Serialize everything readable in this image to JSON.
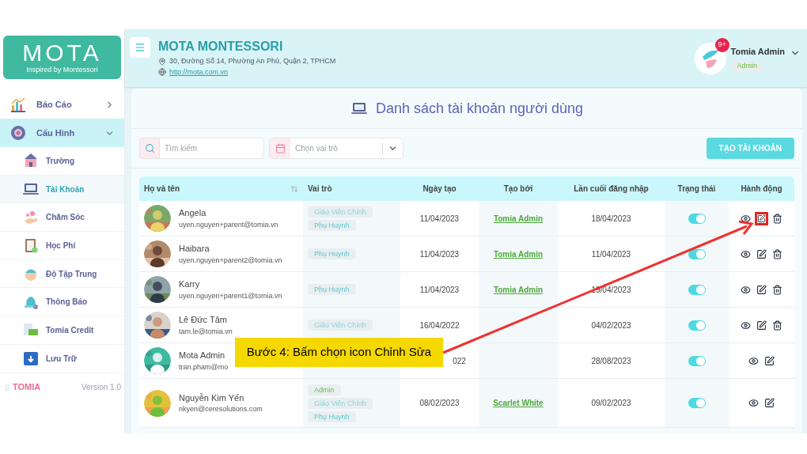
{
  "sidebar": {
    "logo": {
      "title": "MOTA",
      "subtitle": "Inspired by Montessori"
    },
    "items": [
      {
        "label": "Báo Cáo",
        "kind": "chart",
        "selected": false,
        "expanded": false
      },
      {
        "label": "Cấu Hình",
        "kind": "gear",
        "selected": true,
        "expanded": true,
        "children": [
          {
            "label": "Trường",
            "kind": "school",
            "selected": false
          },
          {
            "label": "Tài Khoản",
            "kind": "laptop",
            "selected": true
          },
          {
            "label": "Chăm Sóc",
            "kind": "hand",
            "selected": false
          },
          {
            "label": "Học Phí",
            "kind": "clipboard",
            "selected": false
          },
          {
            "label": "Độ Tập Trung",
            "kind": "face",
            "selected": false
          },
          {
            "label": "Thông Báo",
            "kind": "bell",
            "selected": false
          },
          {
            "label": "Tomia Credit",
            "kind": "card",
            "selected": false
          },
          {
            "label": "Lưu Trữ",
            "kind": "archive",
            "selected": false
          }
        ]
      }
    ],
    "footer": {
      "brand": "TOMIA",
      "version": "Version 1.0"
    }
  },
  "header": {
    "school": "MOTA MONTESSORI",
    "address": "30, Đường Số 14, Phường An Phú, Quận 2, TPHCM",
    "website": "http://mota.com.vn",
    "user": {
      "name": "Tomia Admin",
      "role": "Admin",
      "notifications": "9+"
    }
  },
  "page": {
    "title": "Danh sách tài khoản người dùng",
    "search": {
      "placeholder": "Tìm kiếm"
    },
    "role_select": {
      "placeholder": "Chọn vai trò"
    },
    "create_button": "TẠO TÀI KHOẢN"
  },
  "table": {
    "columns": [
      "Họ và tên",
      "Vai trò",
      "Ngày tạo",
      "Tạo bởi",
      "Lần cuối đăng nhập",
      "Trạng thái",
      "Hành động"
    ],
    "rows": [
      {
        "name": "Angela",
        "email": "uyen.nguyen+parent@tomia.vn",
        "roles": [
          {
            "label": "Giáo Viên Chính",
            "kind": "teacher"
          },
          {
            "label": "Phụ Huynh",
            "kind": "parent"
          }
        ],
        "created": "11/04/2023",
        "created_by": "Tomia Admin",
        "last_login": "18/04/2023",
        "on": true,
        "actions": [
          {
            "kind": "view",
            "highlighted": false
          },
          {
            "kind": "edit",
            "highlighted": true
          },
          {
            "kind": "delete",
            "highlighted": false
          }
        ]
      },
      {
        "name": "Haibara",
        "email": "uyen.nguyen+parent2@tomia.vn",
        "roles": [
          {
            "label": "Phụ Huynh",
            "kind": "parent"
          }
        ],
        "created": "11/04/2023",
        "created_by": "Tomia Admin",
        "last_login": "11/04/2023",
        "on": true,
        "actions": [
          {
            "kind": "view",
            "highlighted": false
          },
          {
            "kind": "edit",
            "highlighted": false
          },
          {
            "kind": "delete",
            "highlighted": false
          }
        ]
      },
      {
        "name": "Karry",
        "email": "uyen.nguyen+parent1@tomia.vn",
        "roles": [
          {
            "label": "Phụ Huynh",
            "kind": "parent"
          }
        ],
        "created": "11/04/2023",
        "created_by": "Tomia Admin",
        "last_login": "19/04/2023",
        "on": true,
        "actions": [
          {
            "kind": "view",
            "highlighted": false
          },
          {
            "kind": "edit",
            "highlighted": false
          },
          {
            "kind": "delete",
            "highlighted": false
          }
        ]
      },
      {
        "name": "Lê Đức Tâm",
        "email": "tam.le@tomia.vn",
        "roles": [
          {
            "label": "Giáo Viên Chính",
            "kind": "teacher"
          }
        ],
        "created": "16/04/2022",
        "last_login": "04/02/2023",
        "on": true,
        "actions": [
          {
            "kind": "view",
            "highlighted": false
          },
          {
            "kind": "edit",
            "highlighted": false
          },
          {
            "kind": "delete",
            "highlighted": false
          }
        ]
      },
      {
        "name": "Mota Admin",
        "email": "tran.pham@mo",
        "created": "022",
        "last_login": "28/08/2023",
        "on": true,
        "actions": [
          {
            "kind": "view",
            "highlighted": false
          },
          {
            "kind": "edit",
            "highlighted": false
          }
        ]
      },
      {
        "name": "Nguyễn Kim Yến",
        "email": "nkyen@ceresolutions.com",
        "roles": [
          {
            "label": "Admin",
            "kind": "admin"
          },
          {
            "label": "Giáo Viên Chính",
            "kind": "teacher"
          },
          {
            "label": "Phụ Huynh",
            "kind": "parent"
          }
        ],
        "created": "08/02/2023",
        "created_by": "Scarlet White",
        "last_login": "09/02/2023",
        "on": true,
        "actions": [
          {
            "kind": "view",
            "highlighted": false
          },
          {
            "kind": "edit",
            "highlighted": false
          }
        ]
      }
    ]
  },
  "annotation": {
    "callout": "Bước 4: Bấm chọn icon Chỉnh Sửa"
  }
}
